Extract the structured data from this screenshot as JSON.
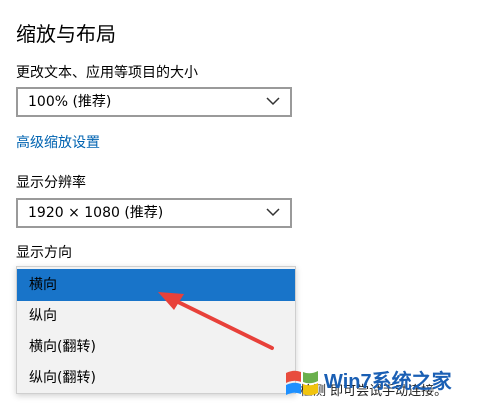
{
  "page": {
    "section_title": "缩放与布局",
    "scale_label": "更改文本、应用等项目的大小",
    "scale_value": "100% (推荐)",
    "advanced_link": "高级缩放设置",
    "resolution_label": "显示分辨率",
    "resolution_value": "1920 × 1080 (推荐)",
    "orientation_label": "显示方向",
    "orientation_options": [
      "横向",
      "纵向",
      "横向(翻转)",
      "纵向(翻转)"
    ],
    "selected_index": 0,
    "bottom_text": "检测 即可尝试手动连接。"
  },
  "watermark": {
    "brand": "Win7系统之家"
  },
  "colors": {
    "selection": "#1874c9",
    "link": "#0063b1",
    "annotation_arrow": "#e8413a"
  },
  "icons": [
    "chevron-down-icon",
    "red-arrow-annotation",
    "windows-logo-icon"
  ]
}
